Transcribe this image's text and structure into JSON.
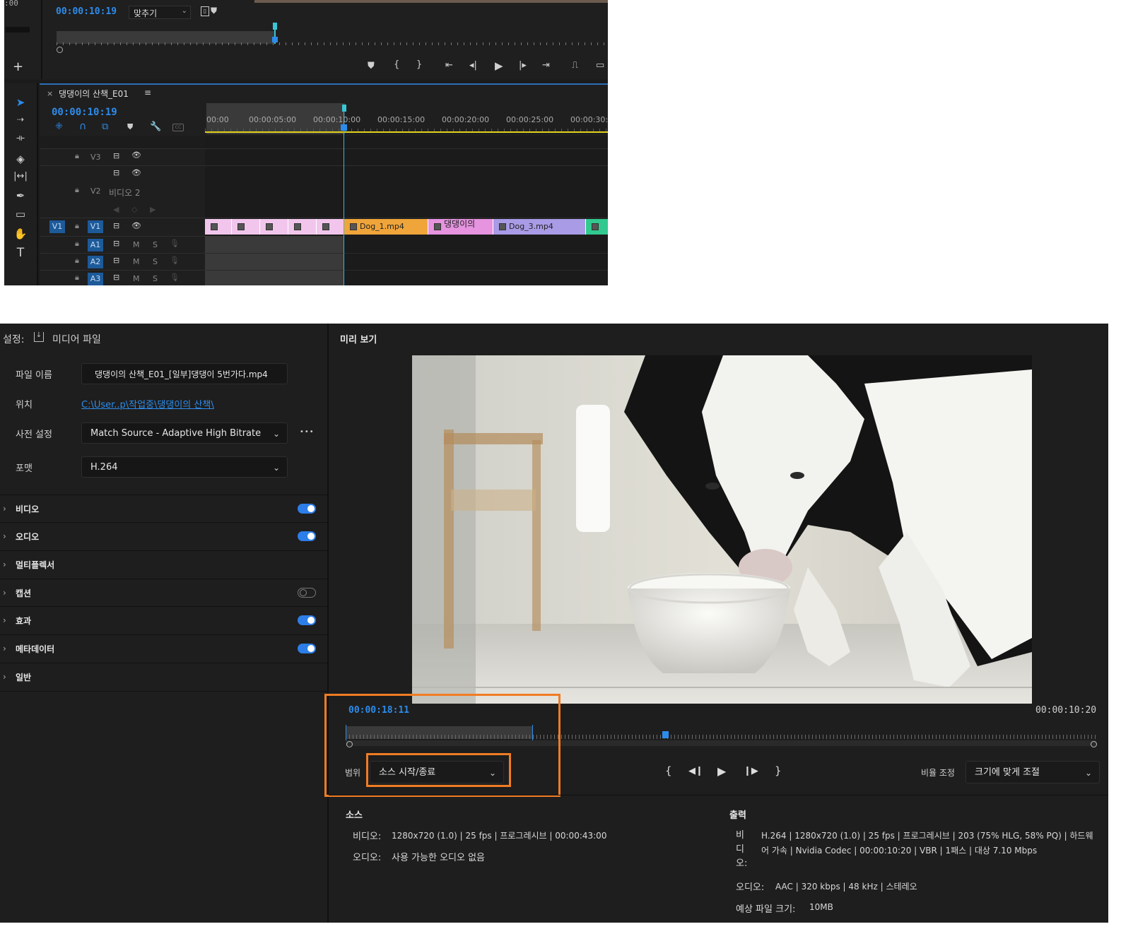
{
  "program_monitor": {
    "timecode": "00:00:10:19",
    "zoom_label": "맞추기",
    "corner_timecode": ":00"
  },
  "sequence": {
    "close_glyph": "×",
    "title": "댕댕이의 산책_E01",
    "menu_glyph": "≡",
    "timecode": "00:00:10:19",
    "ruler_ticks": [
      "00:00",
      "00:00:05:00",
      "00:00:10:00",
      "00:00:15:00",
      "00:00:20:00",
      "00:00:25:00",
      "00:00:30:0"
    ],
    "tracks": {
      "v3": "V3",
      "v2": "V2",
      "v2_name": "비디오 2",
      "v1_source": "V1",
      "v1": "V1",
      "a1": "A1",
      "a2": "A2",
      "a3": "A3",
      "mute": "M",
      "solo": "S"
    },
    "clips": [
      "Dog_1.mp4",
      "댕댕이의",
      "Dog_3.mp4"
    ]
  },
  "settings": {
    "title": "설정:",
    "media_file_label": "미디어 파일",
    "filename_label": "파일 이름",
    "filename_value": "댕댕이의 산책_E01_[일부]댕댕이 5번가다.mp4",
    "location_label": "위치",
    "location_value": "C:\\User..p\\작업중\\댕댕이의 산책\\",
    "preset_label": "사전 설정",
    "preset_value": "Match Source - Adaptive High Bitrate",
    "more_glyph": "•••",
    "format_label": "포맷",
    "format_value": "H.264",
    "sections": [
      {
        "label": "비디오",
        "toggle": "on"
      },
      {
        "label": "오디오",
        "toggle": "on"
      },
      {
        "label": "멀티플렉서",
        "toggle": "none"
      },
      {
        "label": "캡션",
        "toggle": "off"
      },
      {
        "label": "효과",
        "toggle": "on"
      },
      {
        "label": "메타데이터",
        "toggle": "on"
      },
      {
        "label": "일반",
        "toggle": "none"
      }
    ]
  },
  "preview": {
    "title": "미리 보기",
    "current_time": "00:00:18:11",
    "duration": "00:00:10:20",
    "range_label": "범위",
    "range_value": "소스 시작/종료",
    "scale_label": "비율 조정",
    "scale_value": "크기에 맞게 조절"
  },
  "source": {
    "title": "소스",
    "video_label": "비디오:",
    "video_value": "1280x720 (1.0) | 25 fps | 프로그레시브 | 00:00:43:00",
    "audio_label": "오디오:",
    "audio_value": "사용 가능한 오디오 없음"
  },
  "output": {
    "title": "출력",
    "video_label": "비디오:",
    "video_value_line1": "H.264 | 1280x720 (1.0) | 25 fps | 프로그레시브 | 203 (75% HLG, 58% PQ) | 하드웨",
    "video_value_line2": "어 가속 | Nvidia Codec | 00:00:10:20 | VBR | 1패스 | 대상 7.10 Mbps",
    "audio_label": "오디오:",
    "audio_value": "AAC | 320 kbps | 48 kHz | 스테레오",
    "size_label": "예상 파일 크기:",
    "size_value": "10MB"
  },
  "colors": {
    "accent_blue": "#2d8ceb",
    "highlight_orange": "#f07c24",
    "clip_pink": "#f2c6ec",
    "clip_orange": "#f0a53a",
    "clip_magenta": "#e693e0",
    "clip_purple": "#a99be6",
    "clip_green": "#31c98f",
    "playhead": "#39c6d6"
  }
}
